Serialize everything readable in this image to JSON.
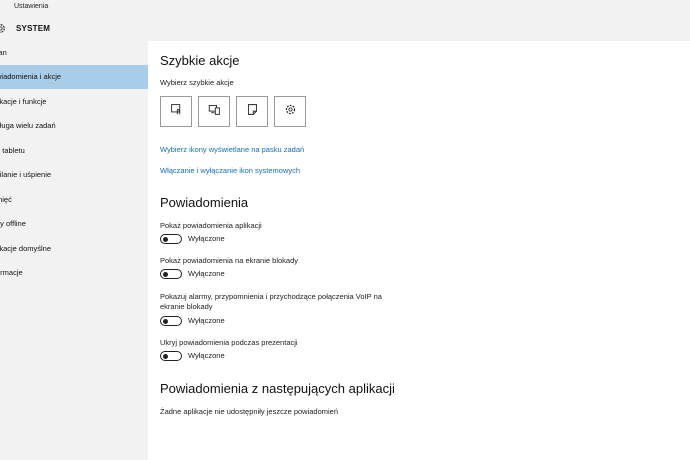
{
  "window": {
    "title": "Ustawienia"
  },
  "header": {
    "title": "SYSTEM",
    "icon": "gear-icon"
  },
  "sidebar": {
    "items": [
      {
        "label": "ran",
        "active": false
      },
      {
        "label": "wiadomienia i akcje",
        "active": true
      },
      {
        "label": "likacje i funkcje",
        "active": false
      },
      {
        "label": "sługa wielu zadań",
        "active": false
      },
      {
        "label": "b tabletu",
        "active": false
      },
      {
        "label": "silanie i uśpienie",
        "active": false
      },
      {
        "label": "mięć",
        "active": false
      },
      {
        "label": "py offline",
        "active": false
      },
      {
        "label": "likacje domyślne",
        "active": false
      },
      {
        "label": "ormacje",
        "active": false
      }
    ],
    "active_color": "#a9cde9"
  },
  "quick_actions": {
    "title": "Szybkie akcje",
    "subtitle": "Wybierz szybkie akcje",
    "buttons": [
      {
        "icon": "tablet-mode-icon"
      },
      {
        "icon": "connect-display-icon"
      },
      {
        "icon": "note-icon"
      },
      {
        "icon": "settings-gear-icon"
      }
    ],
    "link_taskbar_icons": "Wybierz ikony wyświetlane na pasku zadań",
    "link_system_icons": "Włączanie i wyłączanie ikon systemowych"
  },
  "notifications": {
    "title": "Powiadomienia",
    "settings": [
      {
        "label": "Pokaż powiadomienia aplikacji",
        "state": "Wyłączone"
      },
      {
        "label": "Pokaż powiadomienia na ekranie blokady",
        "state": "Wyłączone"
      },
      {
        "label_line1": "Pokazuj alarmy, przypomnienia i przychodzące połączenia VoIP na",
        "label_line2": "ekranie blokady",
        "state": "Wyłączone"
      },
      {
        "label": "Ukryj powiadomienia podczas prezentacji",
        "state": "Wyłączone"
      }
    ]
  },
  "apps_notifications": {
    "title": "Powiadomienia z następujących aplikacji",
    "empty_text": "Żadne aplikacje nie udostępniły jeszcze powiadomień"
  },
  "colors": {
    "link": "#1470b8",
    "background": "#ffffff",
    "sidebar": "#f2f2f2"
  }
}
